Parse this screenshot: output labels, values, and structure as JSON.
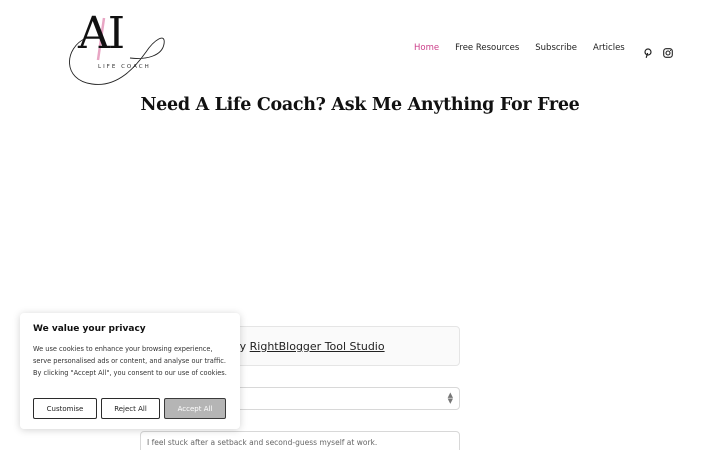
{
  "brand": {
    "logo_letters": "AI",
    "logo_subtitle": "LIFE COACH",
    "accent_color": "#cc3f8a"
  },
  "nav": {
    "items": [
      {
        "label": "Home",
        "active": true
      },
      {
        "label": "Free Resources",
        "active": false
      },
      {
        "label": "Subscribe",
        "active": false
      },
      {
        "label": "Articles",
        "active": false
      }
    ],
    "social_icons": [
      "pinterest-icon",
      "instagram-icon"
    ]
  },
  "page": {
    "title": "Need A Life Coach? Ask Me Anything For Free"
  },
  "tool": {
    "powered_prefix": "ed by ",
    "powered_link": "RightBlogger Tool Studio",
    "select_value": "",
    "textarea_placeholder": "I feel stuck after a setback and second-guess myself at work."
  },
  "cookie_banner": {
    "title": "We value your privacy",
    "body": "We use cookies to enhance your browsing experience, serve personalised ads or content, and analyse our traffic. By clicking \"Accept All\", you consent to our use of cookies.",
    "buttons": {
      "customise": "Customise",
      "reject": "Reject All",
      "accept": "Accept All"
    }
  }
}
